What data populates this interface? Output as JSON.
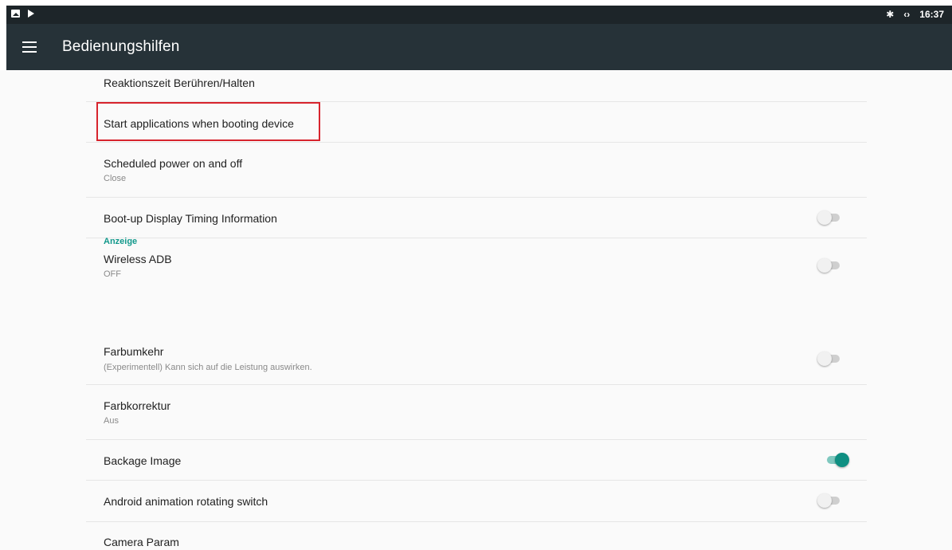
{
  "status_bar": {
    "time": "16:37",
    "left_icons": [
      "gallery-icon",
      "play-icon"
    ],
    "right_icons": [
      "bluetooth-icon",
      "sync-icon"
    ],
    "background": "#1d2529"
  },
  "app_bar": {
    "title": "Bedienungshilfen",
    "menu_icon": "hamburger-menu-icon",
    "background": "#263238"
  },
  "settings": [
    {
      "title": "Reaktionszeit Berühren/Halten"
    },
    {
      "title": "Start applications when booting device",
      "highlighted": true,
      "highlight_color": "#d7242d"
    },
    {
      "title": "Scheduled power on and off",
      "summary": "Close"
    },
    {
      "title": "Boot-up Display Timing Information",
      "toggle": "off"
    },
    {
      "title": "Wireless ADB",
      "summary": "OFF",
      "toggle": "off"
    }
  ],
  "section": {
    "title": "Anzeige",
    "color": "#12988b"
  },
  "display_settings": [
    {
      "title": "Farbumkehr",
      "summary": "(Experimentell) Kann sich auf die Leistung auswirken.",
      "toggle": "off"
    },
    {
      "title": "Farbkorrektur",
      "summary": "Aus"
    },
    {
      "title": "Backage Image",
      "toggle": "on"
    },
    {
      "title": "Android animation rotating switch",
      "toggle": "off"
    },
    {
      "title": "Camera Param"
    }
  ],
  "colors": {
    "accent": "#0f8f82",
    "background": "#fafafa",
    "divider": "#e6e6e6"
  }
}
